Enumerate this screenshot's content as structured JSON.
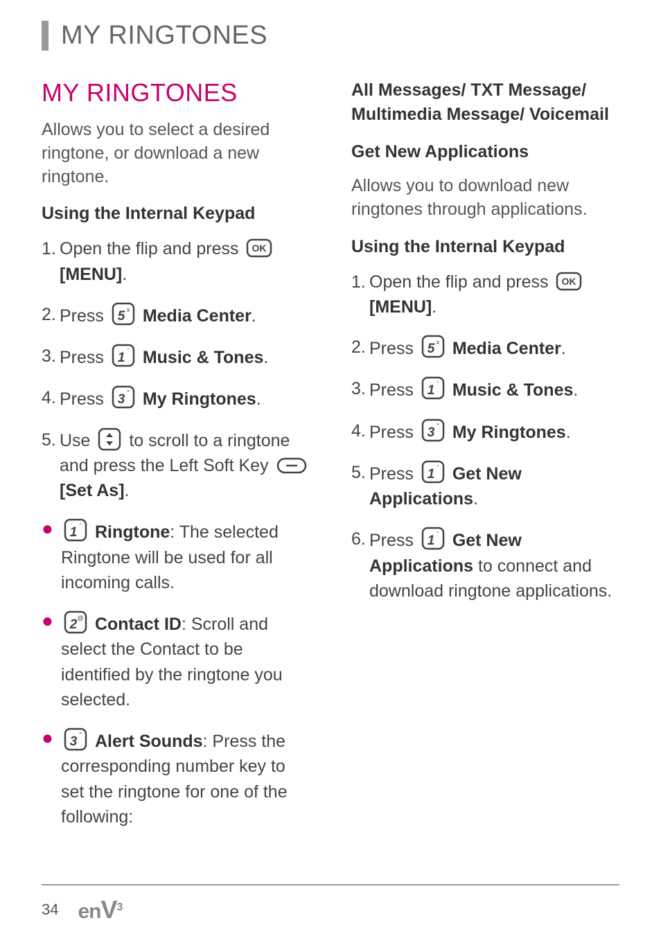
{
  "header": {
    "title": "MY RINGTONES"
  },
  "left": {
    "section_title": "MY RINGTONES",
    "intro": "Allows you to select a desired ringtone, or download a new ringtone.",
    "subheader": "Using the Internal Keypad",
    "steps": [
      {
        "num": "1.",
        "pre": "Open the flip and press ",
        "icon": "ok",
        "after_strong": "[MENU]",
        "after_plain": "."
      },
      {
        "num": "2.",
        "pre": "Press ",
        "icon": "5",
        "after_strong": "Media Center",
        "after_plain": "."
      },
      {
        "num": "3.",
        "pre": "Press ",
        "icon": "1",
        "after_strong": "Music & Tones",
        "after_plain": "."
      },
      {
        "num": "4.",
        "pre": "Press ",
        "icon": "3",
        "after_strong": "My Ringtones",
        "after_plain": "."
      },
      {
        "num": "5.",
        "pre": "Use ",
        "icon": "nav",
        "after_plain_1": " to scroll to a ringtone and press the Left Soft Key ",
        "icon2": "softkey",
        "after_strong": "[Set As]",
        "after_plain_2": "."
      }
    ],
    "bullets": [
      {
        "icon": "1",
        "title": "Ringtone",
        "text": ": The selected Ringtone will be used for all incoming calls."
      },
      {
        "icon": "2",
        "title": "Contact ID",
        "text": ": Scroll and select the Contact to be identified by the ringtone you selected."
      },
      {
        "icon": "3",
        "title": "Alert Sounds",
        "text": ": Press the corresponding number key to set the ringtone for one of the following:"
      }
    ]
  },
  "right": {
    "continuation": "All Messages/ TXT Message/ Multimedia Message/ Voicemail",
    "subheader1": "Get New Applications",
    "intro": "Allows you to download new ringtones through applications.",
    "subheader2": "Using the Internal Keypad",
    "steps": [
      {
        "num": "1.",
        "pre": "Open the flip and press ",
        "icon": "ok",
        "after_strong": "[MENU]",
        "after_plain": "."
      },
      {
        "num": "2.",
        "pre": "Press ",
        "icon": "5",
        "after_strong": "Media Center",
        "after_plain": "."
      },
      {
        "num": "3.",
        "pre": "Press ",
        "icon": "1",
        "after_strong": "Music & Tones",
        "after_plain": "."
      },
      {
        "num": "4.",
        "pre": "Press ",
        "icon": "3",
        "after_strong": "My Ringtones",
        "after_plain": "."
      },
      {
        "num": "5.",
        "pre": "Press ",
        "icon": "1",
        "after_strong": "Get New Applications",
        "after_plain": "."
      },
      {
        "num": "6.",
        "pre": "Press ",
        "icon": "1",
        "after_strong": "Get New Applications",
        "after_plain": " to connect and download ringtone applications."
      }
    ]
  },
  "footer": {
    "page": "34",
    "logo_pre": "en",
    "logo_v": "V",
    "logo_sup": "3"
  }
}
